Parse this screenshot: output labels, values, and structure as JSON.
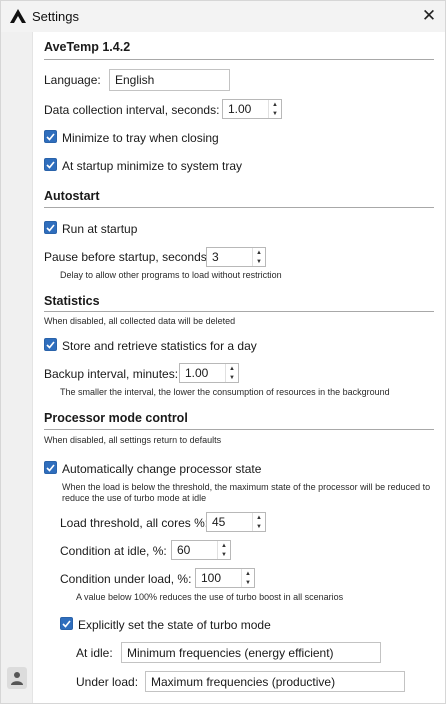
{
  "window": {
    "title": "Settings",
    "close_glyph": "✕",
    "logo_icon": "avetemp-logo-icon",
    "accent_color": "#2f6ebd"
  },
  "app_section": {
    "heading": "AveTemp 1.4.2",
    "language_label": "Language:",
    "language_value": "English",
    "interval_label": "Data collection interval, seconds:",
    "interval_value": "1.00",
    "minimize_to_tray_label": "Minimize to tray when closing",
    "minimize_to_tray_checked": true,
    "startup_minimize_label": "At startup minimize to system tray",
    "startup_minimize_checked": true
  },
  "autostart": {
    "heading": "Autostart",
    "run_at_startup_label": "Run at startup",
    "run_at_startup_checked": true,
    "pause_label": "Pause before startup, seconds:",
    "pause_value": "3",
    "pause_hint": "Delay to allow other programs to load without restriction"
  },
  "statistics": {
    "heading": "Statistics",
    "note": "When disabled, all collected data will be deleted",
    "store_label": "Store and retrieve statistics for a day",
    "store_checked": true,
    "backup_label": "Backup interval, minutes:",
    "backup_value": "1.00",
    "backup_hint": "The smaller the interval, the lower the consumption of resources in the background"
  },
  "processor": {
    "heading": "Processor mode control",
    "note": "When disabled, all settings return to defaults",
    "auto_change_label": "Automatically change processor state",
    "auto_change_checked": true,
    "auto_change_hint_1": "When the load is below the threshold, the maximum state of the processor will be reduced to",
    "auto_change_hint_2": "reduce the use of turbo mode at idle",
    "load_threshold_label": "Load threshold, all cores %:",
    "load_threshold_value": "45",
    "idle_condition_label": "Condition at idle, %:",
    "idle_condition_value": "60",
    "load_condition_label": "Condition under load, %:",
    "load_condition_value": "100",
    "load_condition_hint": "A value below 100% reduces the use of turbo boost in all scenarios",
    "turbo_label": "Explicitly set the state of turbo mode",
    "turbo_checked": true,
    "at_idle_label": "At idle:",
    "at_idle_value": "Minimum frequencies (energy efficient)",
    "under_load_label": "Under load:",
    "under_load_value": "Maximum frequencies (productive)"
  },
  "sidebar": {
    "bottom_icon": "profile-icon"
  }
}
